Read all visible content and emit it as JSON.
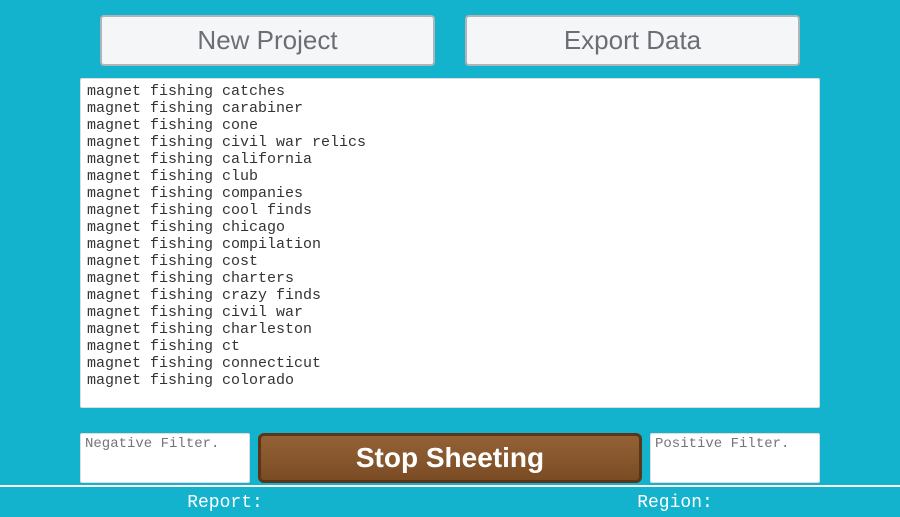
{
  "toolbar": {
    "new_project_label": "New Project",
    "export_data_label": "Export Data"
  },
  "main_list": {
    "value": "magnet fishing catches\nmagnet fishing carabiner\nmagnet fishing cone\nmagnet fishing civil war relics\nmagnet fishing california\nmagnet fishing club\nmagnet fishing companies\nmagnet fishing cool finds\nmagnet fishing chicago\nmagnet fishing compilation\nmagnet fishing cost\nmagnet fishing charters\nmagnet fishing crazy finds\nmagnet fishing civil war\nmagnet fishing charleston\nmagnet fishing ct\nmagnet fishing connecticut\nmagnet fishing colorado"
  },
  "filters": {
    "negative_placeholder": "Negative Filter.",
    "positive_placeholder": "Positive Filter.",
    "stop_label": "Stop Sheeting"
  },
  "bottom": {
    "report_label": "Report:",
    "region_label": "Region:"
  }
}
